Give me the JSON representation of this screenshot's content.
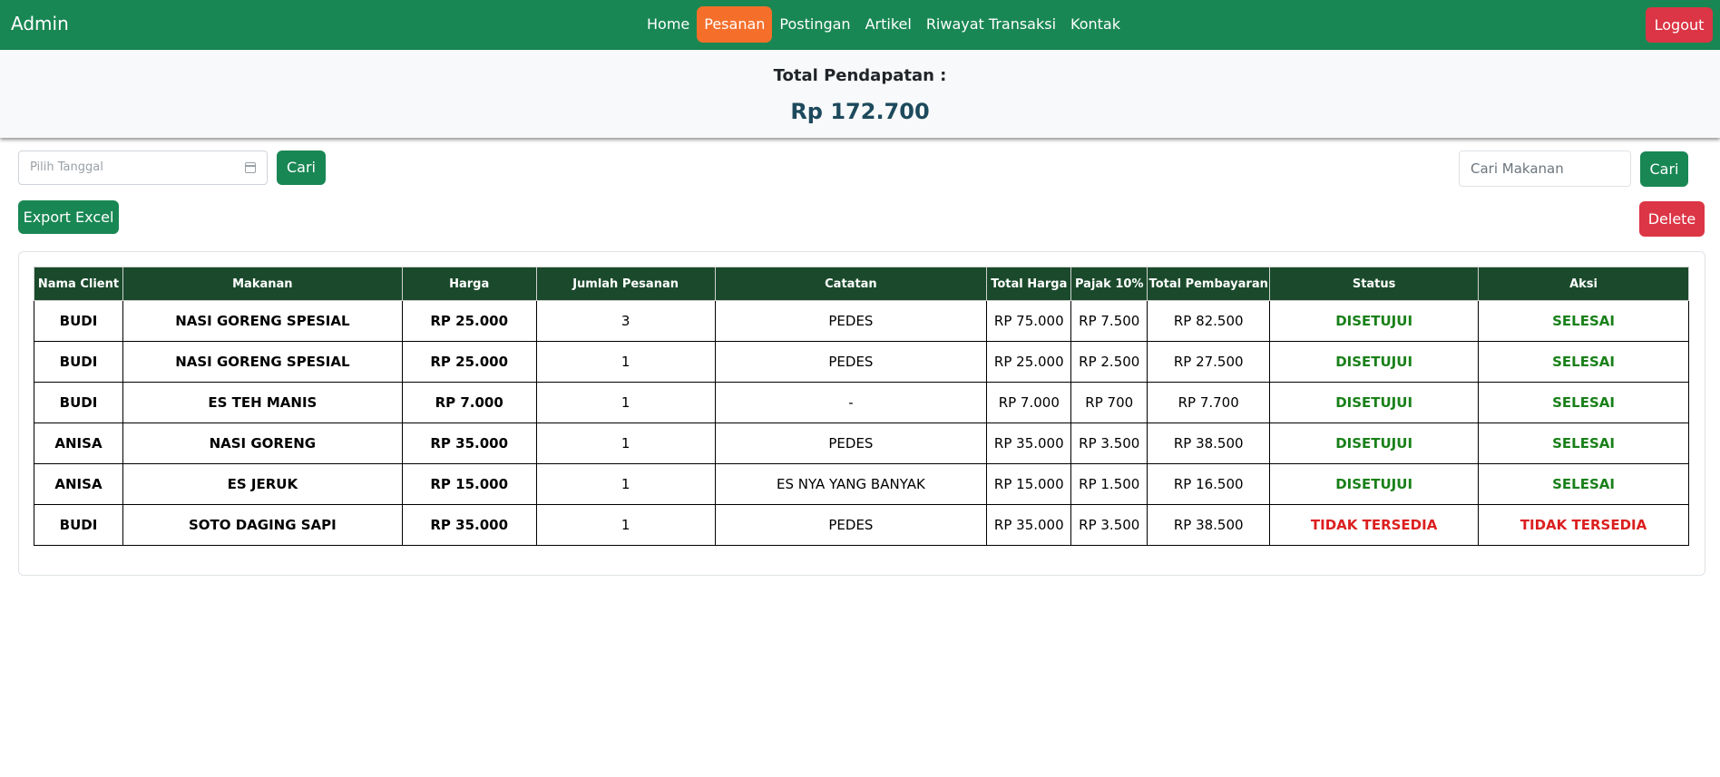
{
  "nav": {
    "brand": "Admin",
    "items": [
      {
        "label": "Home"
      },
      {
        "label": "Pesanan"
      },
      {
        "label": "Postingan"
      },
      {
        "label": "Artikel"
      },
      {
        "label": "Riwayat Transaksi"
      },
      {
        "label": "Kontak"
      }
    ],
    "active": "Pesanan",
    "logout": "Logout"
  },
  "summary": {
    "label": "Total Pendapatan :",
    "value": "Rp 172.700"
  },
  "filters": {
    "date_placeholder": "Pilih Tanggal",
    "date_search_label": "Cari",
    "food_placeholder": "Cari Makanan",
    "food_search_label": "Cari",
    "export_label": "Export Excel",
    "delete_label": "Delete"
  },
  "table": {
    "headers": [
      "Nama Client",
      "Makanan",
      "Harga",
      "Jumlah Pesanan",
      "Catatan",
      "Total Harga",
      "Pajak 10%",
      "Total Pembayaran",
      "Status",
      "Aksi"
    ],
    "rows": [
      {
        "client": "BUDI",
        "food": "NASI GORENG SPESIAL",
        "price": "RP 25.000",
        "qty": "3",
        "note": "PEDES",
        "total": "RP 75.000",
        "tax": "RP 7.500",
        "payment": "RP 82.500",
        "status": "DISETUJUI",
        "action": "SELESAI",
        "state": "ok"
      },
      {
        "client": "BUDI",
        "food": "NASI GORENG SPESIAL",
        "price": "RP 25.000",
        "qty": "1",
        "note": "PEDES",
        "total": "RP 25.000",
        "tax": "RP 2.500",
        "payment": "RP 27.500",
        "status": "DISETUJUI",
        "action": "SELESAI",
        "state": "ok"
      },
      {
        "client": "BUDI",
        "food": "ES TEH MANIS",
        "price": "RP 7.000",
        "qty": "1",
        "note": "-",
        "total": "RP 7.000",
        "tax": "RP 700",
        "payment": "RP 7.700",
        "status": "DISETUJUI",
        "action": "SELESAI",
        "state": "ok"
      },
      {
        "client": "ANISA",
        "food": "NASI GORENG",
        "price": "RP 35.000",
        "qty": "1",
        "note": "PEDES",
        "total": "RP 35.000",
        "tax": "RP 3.500",
        "payment": "RP 38.500",
        "status": "DISETUJUI",
        "action": "SELESAI",
        "state": "ok"
      },
      {
        "client": "ANISA",
        "food": "ES JERUK",
        "price": "RP 15.000",
        "qty": "1",
        "note": "ES NYA YANG BANYAK",
        "total": "RP 15.000",
        "tax": "RP 1.500",
        "payment": "RP 16.500",
        "status": "DISETUJUI",
        "action": "SELESAI",
        "state": "ok"
      },
      {
        "client": "BUDI",
        "food": "SOTO DAGING SAPI",
        "price": "RP 35.000",
        "qty": "1",
        "note": "PEDES",
        "total": "RP 35.000",
        "tax": "RP 3.500",
        "payment": "RP 38.500",
        "status": "TIDAK TERSEDIA",
        "action": "TIDAK TERSEDIA",
        "state": "na"
      }
    ]
  },
  "colors": {
    "primary": "#198754",
    "active_nav": "#f56f2b",
    "danger": "#dc3545",
    "header_bg": "#1a4a2b",
    "approved_text": "#198019",
    "unavailable_text": "#dc1f1f",
    "revenue_text": "#1d4a5c"
  }
}
